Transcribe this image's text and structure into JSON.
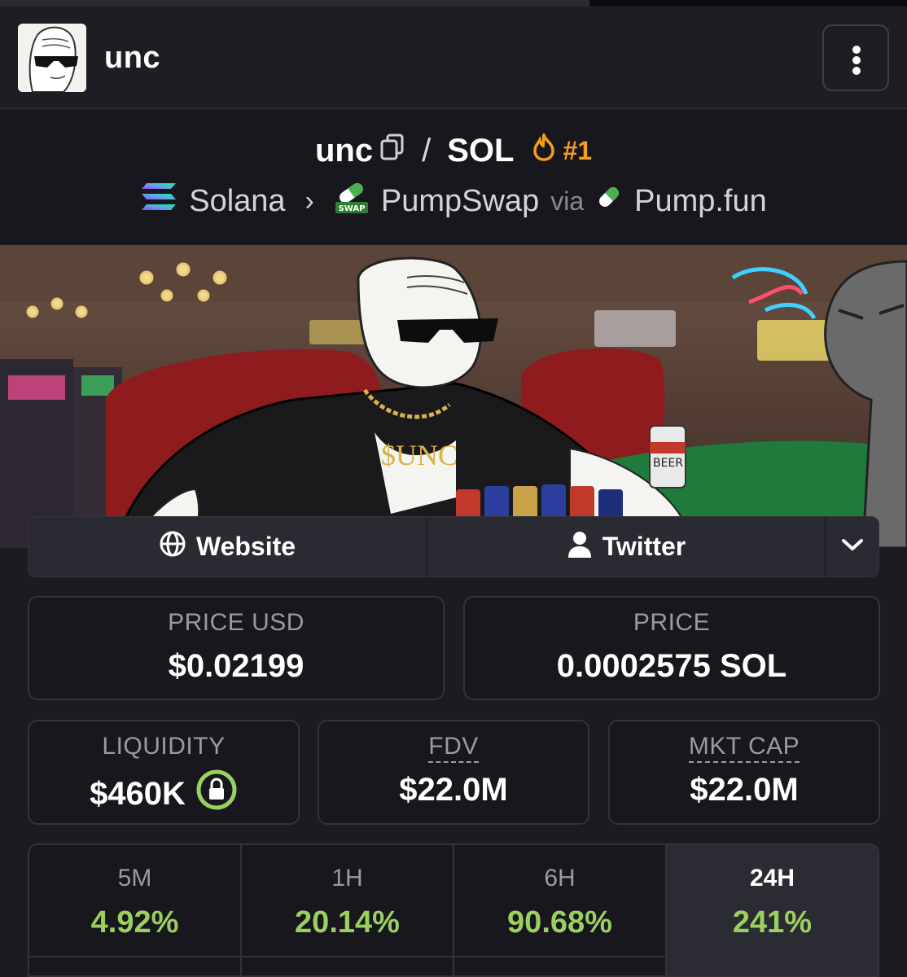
{
  "header": {
    "token_name": "unc"
  },
  "pair": {
    "base": "unc",
    "quote": "SOL",
    "separator": "/",
    "rank": "#1",
    "chain": "Solana",
    "dex": "PumpSwap",
    "via": "via",
    "launchpad": "Pump.fun",
    "dex_badge": "SWAP"
  },
  "banner": {
    "shirt_text": "$UNC",
    "can_text": "BEER"
  },
  "links": {
    "website": "Website",
    "twitter": "Twitter"
  },
  "stats": {
    "price_usd": {
      "label": "PRICE USD",
      "value": "$0.02199"
    },
    "price": {
      "label": "PRICE",
      "value": "0.0002575 SOL"
    },
    "liquidity": {
      "label": "LIQUIDITY",
      "value": "$460K"
    },
    "fdv": {
      "label": "FDV",
      "value": "$22.0M"
    },
    "mkt_cap": {
      "label": "MKT CAP",
      "value": "$22.0M"
    }
  },
  "changes": [
    {
      "period": "5M",
      "pct": "4.92%"
    },
    {
      "period": "1H",
      "pct": "20.14%"
    },
    {
      "period": "6H",
      "pct": "90.68%"
    },
    {
      "period": "24H",
      "pct": "241%",
      "active": true
    }
  ],
  "colors": {
    "accent_orange": "#f59e1b",
    "positive_green": "#9bd05e",
    "lock_green": "#9bd05e"
  }
}
